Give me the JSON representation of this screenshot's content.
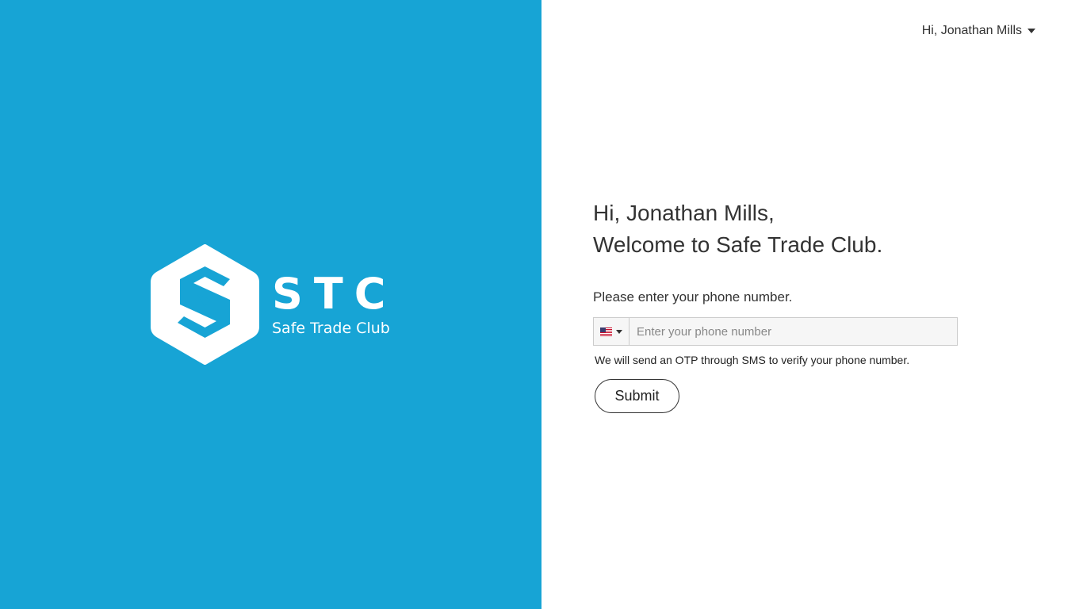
{
  "brand": {
    "abbr": "STC",
    "name": "Safe Trade Club",
    "panel_color": "#17a4d5"
  },
  "header": {
    "user_menu_label": "Hi, Jonathan Mills",
    "user_menu_icon": "chevron-down-icon"
  },
  "form": {
    "greeting_line1": "Hi, Jonathan Mills,",
    "greeting_line2": "Welcome to Safe Trade Club.",
    "prompt": "Please enter your phone number.",
    "country_flag_icon": "us-flag-icon",
    "phone_value": "",
    "phone_placeholder": "Enter your phone number",
    "otp_note": "We will send an OTP through SMS to verify your phone number.",
    "submit_label": "Submit"
  }
}
